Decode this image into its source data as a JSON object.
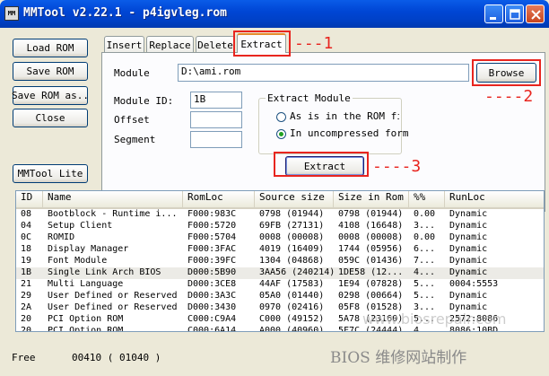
{
  "window": {
    "title": "MMTool v2.22.1 - p4igvleg.rom",
    "icon_text": "MM",
    "minimize_icon": "minimize-icon",
    "maximize_icon": "maximize-icon",
    "close_icon": "close-icon"
  },
  "left_buttons": {
    "load_rom": "Load ROM",
    "save_rom": "Save ROM",
    "save_rom_as": "Save ROM as..",
    "close": "Close",
    "mmtool_lite": "MMTool Lite"
  },
  "tabs": [
    {
      "label": "Insert",
      "active": false
    },
    {
      "label": "Replace",
      "active": false
    },
    {
      "label": "Delete",
      "active": false
    },
    {
      "label": "Extract",
      "active": true
    }
  ],
  "extract": {
    "module_label": "Module",
    "module_value": "D:\\ami.rom",
    "browse_label": "Browse",
    "module_id_label": "Module ID:",
    "module_id_value": "1B",
    "offset_label": "Offset",
    "offset_value": "",
    "segment_label": "Segment",
    "segment_value": "",
    "group_title": "Extract Module",
    "option_as_is": "As is in the ROM file",
    "option_uncompressed": "In uncompressed form",
    "selected_option": "uncompressed",
    "extract_button": "Extract"
  },
  "annotations": {
    "one": "---1",
    "two": "----2",
    "three": "----3",
    "color": "#e8251f"
  },
  "table": {
    "columns": [
      "ID",
      "Name",
      "RomLoc",
      "Source size",
      "Size in Rom",
      "%%",
      "RunLoc"
    ],
    "rows": [
      [
        "08",
        "Bootblock - Runtime i...",
        "F000:983C",
        "0798 (01944)",
        "0798 (01944)",
        "0.00",
        "Dynamic"
      ],
      [
        "04",
        "Setup Client",
        "F000:5720",
        "69FB (27131)",
        "4108 (16648)",
        "3...",
        "Dynamic"
      ],
      [
        "0C",
        "ROMID",
        "F000:5704",
        "0008 (00008)",
        "0008 (00008)",
        "0.00",
        "Dynamic"
      ],
      [
        "18",
        "Display Manager",
        "F000:3FAC",
        "4019 (16409)",
        "1744 (05956)",
        "6...",
        "Dynamic"
      ],
      [
        "19",
        "Font Module",
        "F000:39FC",
        "1304 (04868)",
        "059C (01436)",
        "7...",
        "Dynamic"
      ],
      [
        "1B",
        "Single Link Arch BIOS",
        "D000:5B90",
        "3AA56 (240214)",
        "1DE58 (12...",
        "4...",
        "Dynamic"
      ],
      [
        "21",
        "Multi Language",
        "D000:3CE8",
        "44AF (17583)",
        "1E94 (07828)",
        "5...",
        "0004:5553"
      ],
      [
        "29",
        "User Defined or Reserved",
        "D000:3A3C",
        "05A0 (01440)",
        "0298 (00664)",
        "5...",
        "Dynamic"
      ],
      [
        "2A",
        "User Defined or Reserved",
        "D000:3430",
        "0970 (02416)",
        "05F8 (01528)",
        "3...",
        "Dynamic"
      ],
      [
        "20",
        "PCI Option ROM",
        "C000:C9A4",
        "C000 (49152)",
        "5A78 (23160)",
        "5...",
        "2572:8086"
      ],
      [
        "20",
        "PCI Option ROM",
        "C000:6A14",
        "A000 (40960)",
        "5F7C (24444)",
        "4...",
        "8086:10BD"
      ]
    ],
    "selected_row": 5
  },
  "status": {
    "free_label": "Free",
    "free_value": "00410 ( 01040 )"
  },
  "watermark": {
    "main": "BIOS 维修网站制作",
    "faint": "www.biosrepair.com"
  }
}
